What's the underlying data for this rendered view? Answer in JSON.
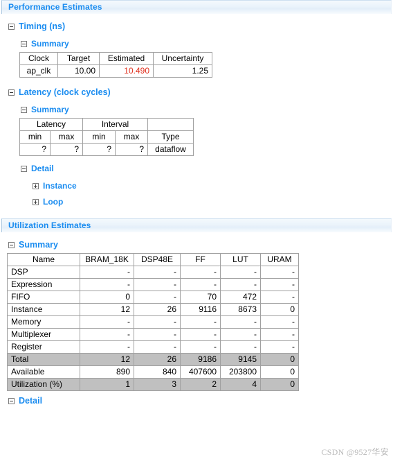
{
  "sections": [
    {
      "id": "performance",
      "title": "Performance Estimates",
      "groups": {
        "timing": {
          "label": "Timing (ns)",
          "summary_label": "Summary",
          "table": {
            "headers": [
              "Clock",
              "Target",
              "Estimated",
              "Uncertainty"
            ],
            "rows": [
              {
                "clock": "ap_clk",
                "target": "10.00",
                "estimated": "10.490",
                "uncertainty": "1.25"
              }
            ]
          }
        },
        "latency": {
          "label": "Latency (clock cycles)",
          "summary_label": "Summary",
          "detail_label": "Detail",
          "detail_items": [
            "Instance",
            "Loop"
          ],
          "table": {
            "group_headers": [
              "Latency",
              "Interval",
              ""
            ],
            "sub_headers": [
              "min",
              "max",
              "min",
              "max",
              "Type"
            ],
            "rows": [
              {
                "latency_min": "?",
                "latency_max": "?",
                "interval_min": "?",
                "interval_max": "?",
                "type": "dataflow"
              }
            ]
          }
        }
      }
    },
    {
      "id": "utilization",
      "title": "Utilization Estimates",
      "summary_label": "Summary",
      "detail_label": "Detail",
      "table": {
        "headers": [
          "Name",
          "BRAM_18K",
          "DSP48E",
          "FF",
          "LUT",
          "URAM"
        ],
        "rows": [
          {
            "name": "DSP",
            "bram": "-",
            "dsp": "-",
            "ff": "-",
            "lut": "-",
            "uram": "-",
            "shaded": false
          },
          {
            "name": "Expression",
            "bram": "-",
            "dsp": "-",
            "ff": "-",
            "lut": "-",
            "uram": "-",
            "shaded": false
          },
          {
            "name": "FIFO",
            "bram": "0",
            "dsp": "-",
            "ff": "70",
            "lut": "472",
            "uram": "-",
            "shaded": false
          },
          {
            "name": "Instance",
            "bram": "12",
            "dsp": "26",
            "ff": "9116",
            "lut": "8673",
            "uram": "0",
            "shaded": false
          },
          {
            "name": "Memory",
            "bram": "-",
            "dsp": "-",
            "ff": "-",
            "lut": "-",
            "uram": "-",
            "shaded": false
          },
          {
            "name": "Multiplexer",
            "bram": "-",
            "dsp": "-",
            "ff": "-",
            "lut": "-",
            "uram": "-",
            "shaded": false
          },
          {
            "name": "Register",
            "bram": "-",
            "dsp": "-",
            "ff": "-",
            "lut": "-",
            "uram": "-",
            "shaded": false
          },
          {
            "name": "Total",
            "bram": "12",
            "dsp": "26",
            "ff": "9186",
            "lut": "9145",
            "uram": "0",
            "shaded": true
          },
          {
            "name": "Available",
            "bram": "890",
            "dsp": "840",
            "ff": "407600",
            "lut": "203800",
            "uram": "0",
            "shaded": false
          },
          {
            "name": "Utilization (%)",
            "bram": "1",
            "dsp": "3",
            "ff": "2",
            "lut": "4",
            "uram": "0",
            "shaded": true
          }
        ]
      }
    }
  ],
  "watermark": "CSDN @9527华安",
  "colors": {
    "heading_blue": "#1a8cf0",
    "warning_red": "#e0301e",
    "shaded_row": "#c0c0c0",
    "table_border": "#a0a0a0"
  }
}
